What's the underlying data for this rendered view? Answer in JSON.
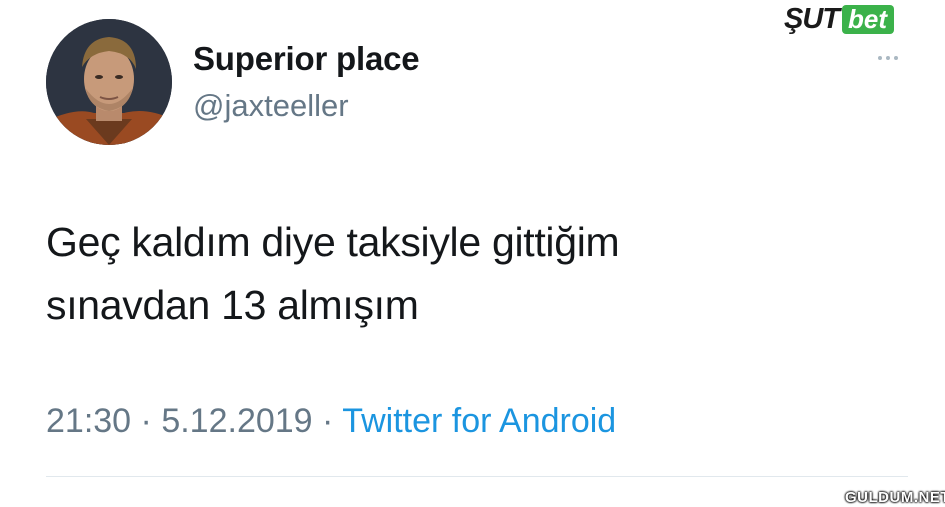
{
  "tweet": {
    "display_name": "Superior place",
    "handle": "@jaxteeller",
    "text_lines": [
      "Geç kaldım diye taksiyle gittiğim",
      "sınavdan 13 almışım"
    ],
    "time": "21:30",
    "separator": "·",
    "date": "5.12.2019",
    "source": "Twitter for Android"
  },
  "icons": {
    "more": "more-options-icon"
  },
  "overlays": {
    "brand_part1": "ŞUT",
    "brand_part2": "bet",
    "watermark": "GULDUM.NET"
  },
  "colors": {
    "source_link": "#1b95e0",
    "secondary_text": "#657786",
    "brand_green": "#3bb24a"
  }
}
